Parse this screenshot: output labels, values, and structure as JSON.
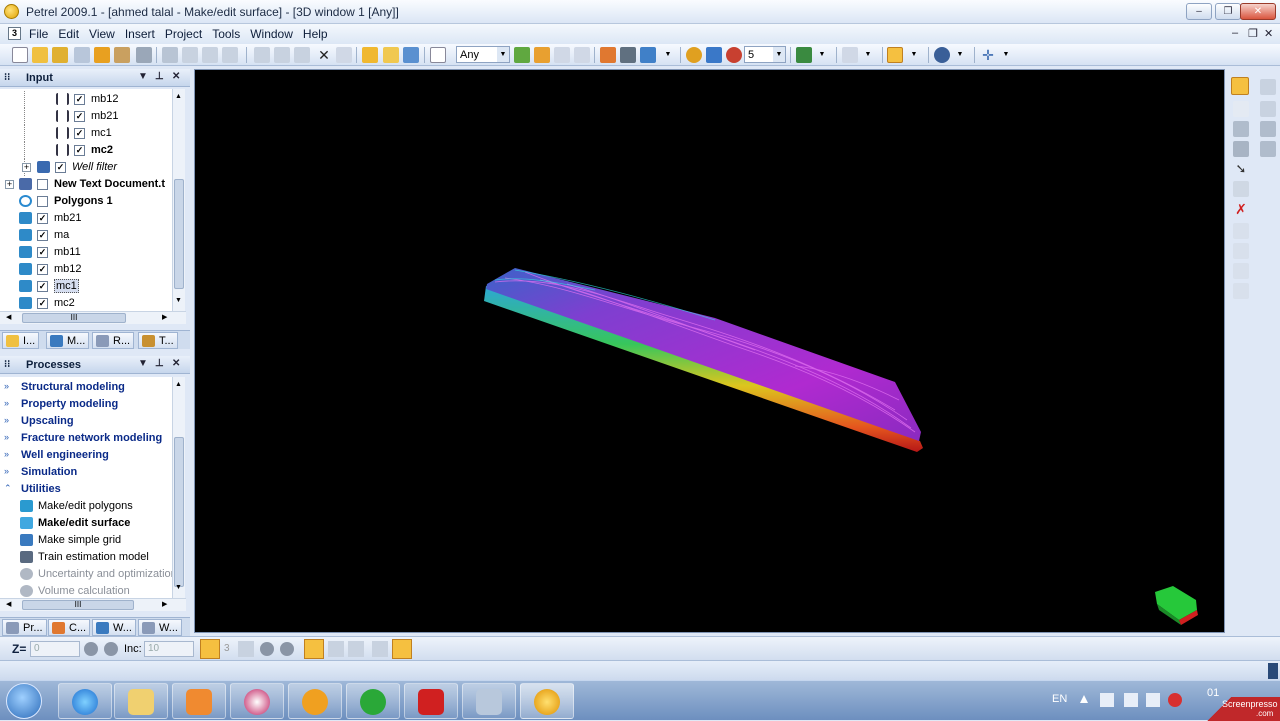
{
  "window": {
    "title": "Petrel 2009.1 - [ahmed talal - Make/edit surface] - [3D window 1 [Any]]",
    "minimize": "‒",
    "restore": "❐",
    "close": "✕"
  },
  "menu": {
    "items": [
      "File",
      "Edit",
      "View",
      "Insert",
      "Project",
      "Tools",
      "Window",
      "Help"
    ],
    "sys_label": "3",
    "mdi_minimize": "–",
    "mdi_restore": "❐",
    "mdi_close": "✕"
  },
  "toolbar": {
    "domain_select": "Any",
    "number_select": "5"
  },
  "input_panel": {
    "title": "Input",
    "items": [
      {
        "label": "mb12",
        "checked": true,
        "bold": false
      },
      {
        "label": "mb21",
        "checked": true,
        "bold": false
      },
      {
        "label": "mc1",
        "checked": true,
        "bold": false
      },
      {
        "label": "mc2",
        "checked": true,
        "bold": true
      },
      {
        "label": "Well filter",
        "checked": true,
        "italic": true
      },
      {
        "label": "New Text Document.t",
        "checked": false,
        "bold": true
      },
      {
        "label": "Polygons 1",
        "checked": false,
        "bold": true
      },
      {
        "label": "mb21",
        "checked": true,
        "bold": false
      },
      {
        "label": "ma",
        "checked": true,
        "bold": false
      },
      {
        "label": "mb11",
        "checked": true,
        "bold": false
      },
      {
        "label": "mb12",
        "checked": true,
        "bold": false
      },
      {
        "label": "mc1",
        "checked": true,
        "bold": false,
        "selected": true
      },
      {
        "label": "mc2",
        "checked": true,
        "bold": false
      }
    ],
    "tabs": [
      "I...",
      "M...",
      "R...",
      "T..."
    ],
    "scroll_label": "III"
  },
  "processes_panel": {
    "title": "Processes",
    "categories": [
      "Structural modeling",
      "Property modeling",
      "Upscaling",
      "Fracture network modeling",
      "Well engineering",
      "Simulation",
      "Utilities"
    ],
    "utilities": [
      {
        "label": "Make/edit polygons",
        "bold": false,
        "disabled": false
      },
      {
        "label": "Make/edit surface",
        "bold": true,
        "disabled": false
      },
      {
        "label": "Make simple grid",
        "bold": false,
        "disabled": false
      },
      {
        "label": "Train estimation model",
        "bold": false,
        "disabled": false
      },
      {
        "label": "Uncertainty and optimization",
        "bold": false,
        "disabled": true
      },
      {
        "label": "Volume calculation",
        "bold": false,
        "disabled": true
      }
    ],
    "tabs": [
      "Pr...",
      "C...",
      "W...",
      "W..."
    ],
    "scroll_label": "III"
  },
  "zbar": {
    "z_label": "Z=",
    "z_value": "0",
    "inc_label": "Inc:",
    "inc_value": "10",
    "count_value": "3"
  },
  "taskbar": {
    "language": "EN",
    "clock": "01",
    "watermark": "Screenpresso",
    "watermark_sub": ".com"
  },
  "colors": {
    "viewport_bg": "#000000",
    "surface_top": "#a020c8",
    "surface_side": "#e02020"
  }
}
